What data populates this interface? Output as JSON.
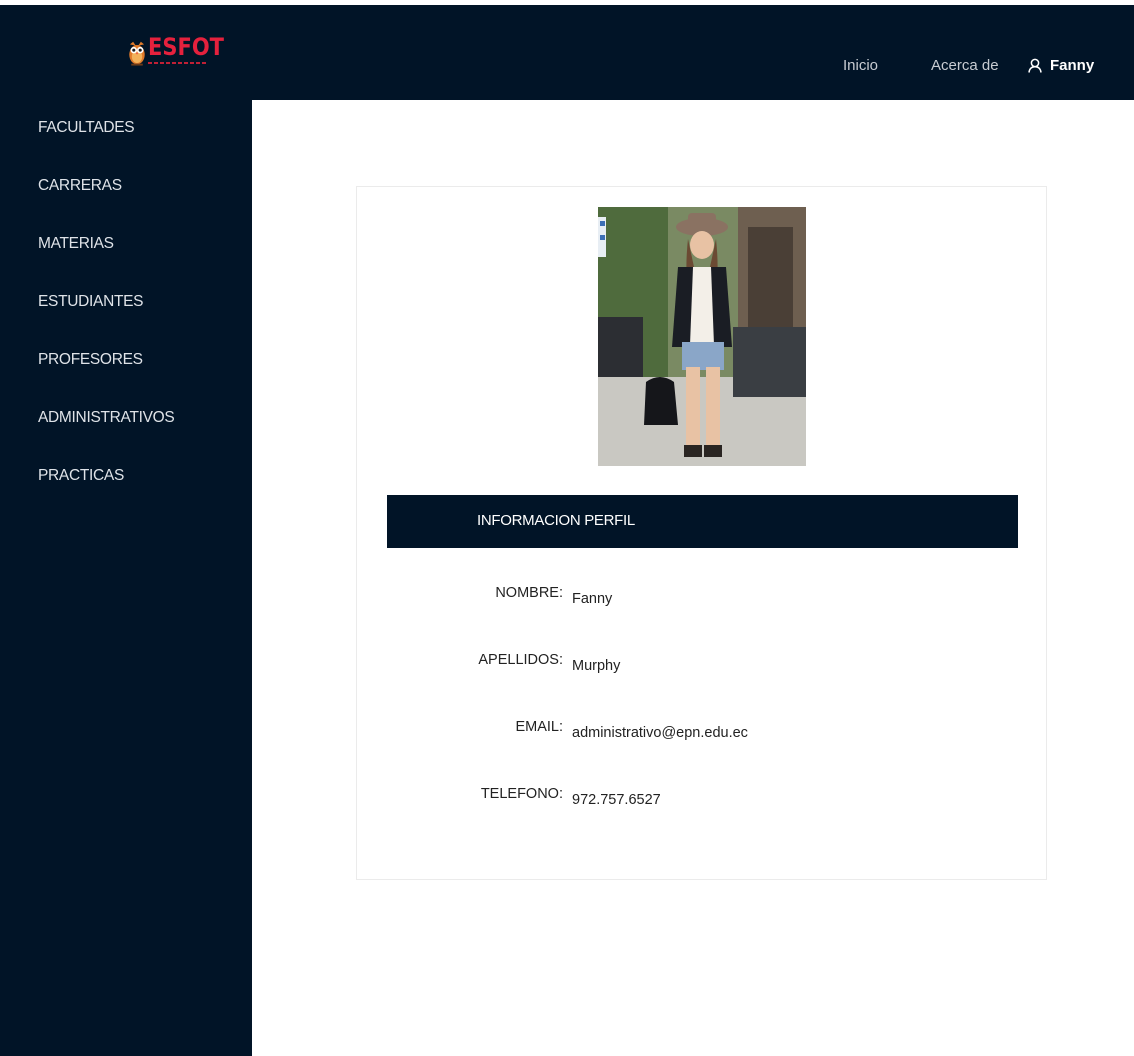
{
  "app": {
    "logo_text": "ESFOT"
  },
  "header": {
    "nav_inicio": "Inicio",
    "nav_acerca": "Acerca de",
    "user_name": "Fanny"
  },
  "sidebar": {
    "items": [
      {
        "label": "FACULTADES"
      },
      {
        "label": "CARRERAS"
      },
      {
        "label": "MATERIAS"
      },
      {
        "label": "ESTUDIANTES"
      },
      {
        "label": "PROFESORES"
      },
      {
        "label": "ADMINISTRATIVOS"
      },
      {
        "label": "PRACTICAS"
      }
    ]
  },
  "profile": {
    "section_title": "INFORMACION PERFIL",
    "fields": [
      {
        "label": "NOMBRE:",
        "value": "Fanny"
      },
      {
        "label": "APELLIDOS:",
        "value": "Murphy"
      },
      {
        "label": "EMAIL:",
        "value": "administrativo@epn.edu.ec"
      },
      {
        "label": "TELEFONO:",
        "value": "972.757.6527"
      }
    ]
  },
  "colors": {
    "navy": "#011427",
    "logo_red": "#e5213d",
    "nav_text": "#c8ccd2",
    "card_border": "#ebebeb"
  },
  "icons": {
    "user": "user-icon",
    "logo": "owl-logo-icon"
  }
}
